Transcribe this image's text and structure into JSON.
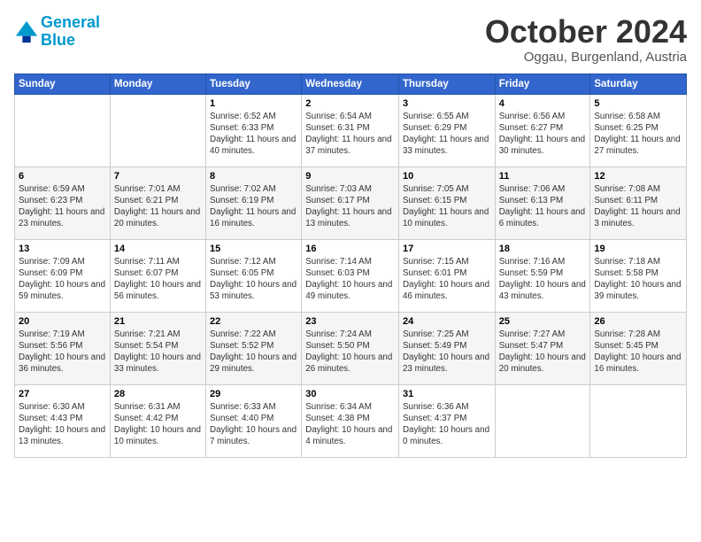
{
  "header": {
    "logo_line1": "General",
    "logo_line2": "Blue",
    "month_title": "October 2024",
    "location": "Oggau, Burgenland, Austria"
  },
  "weekdays": [
    "Sunday",
    "Monday",
    "Tuesday",
    "Wednesday",
    "Thursday",
    "Friday",
    "Saturday"
  ],
  "weeks": [
    [
      {
        "day": null
      },
      {
        "day": null
      },
      {
        "day": "1",
        "sunrise": "6:52 AM",
        "sunset": "6:33 PM",
        "daylight": "11 hours and 40 minutes."
      },
      {
        "day": "2",
        "sunrise": "6:54 AM",
        "sunset": "6:31 PM",
        "daylight": "11 hours and 37 minutes."
      },
      {
        "day": "3",
        "sunrise": "6:55 AM",
        "sunset": "6:29 PM",
        "daylight": "11 hours and 33 minutes."
      },
      {
        "day": "4",
        "sunrise": "6:56 AM",
        "sunset": "6:27 PM",
        "daylight": "11 hours and 30 minutes."
      },
      {
        "day": "5",
        "sunrise": "6:58 AM",
        "sunset": "6:25 PM",
        "daylight": "11 hours and 27 minutes."
      }
    ],
    [
      {
        "day": "6",
        "sunrise": "6:59 AM",
        "sunset": "6:23 PM",
        "daylight": "11 hours and 23 minutes."
      },
      {
        "day": "7",
        "sunrise": "7:01 AM",
        "sunset": "6:21 PM",
        "daylight": "11 hours and 20 minutes."
      },
      {
        "day": "8",
        "sunrise": "7:02 AM",
        "sunset": "6:19 PM",
        "daylight": "11 hours and 16 minutes."
      },
      {
        "day": "9",
        "sunrise": "7:03 AM",
        "sunset": "6:17 PM",
        "daylight": "11 hours and 13 minutes."
      },
      {
        "day": "10",
        "sunrise": "7:05 AM",
        "sunset": "6:15 PM",
        "daylight": "11 hours and 10 minutes."
      },
      {
        "day": "11",
        "sunrise": "7:06 AM",
        "sunset": "6:13 PM",
        "daylight": "11 hours and 6 minutes."
      },
      {
        "day": "12",
        "sunrise": "7:08 AM",
        "sunset": "6:11 PM",
        "daylight": "11 hours and 3 minutes."
      }
    ],
    [
      {
        "day": "13",
        "sunrise": "7:09 AM",
        "sunset": "6:09 PM",
        "daylight": "10 hours and 59 minutes."
      },
      {
        "day": "14",
        "sunrise": "7:11 AM",
        "sunset": "6:07 PM",
        "daylight": "10 hours and 56 minutes."
      },
      {
        "day": "15",
        "sunrise": "7:12 AM",
        "sunset": "6:05 PM",
        "daylight": "10 hours and 53 minutes."
      },
      {
        "day": "16",
        "sunrise": "7:14 AM",
        "sunset": "6:03 PM",
        "daylight": "10 hours and 49 minutes."
      },
      {
        "day": "17",
        "sunrise": "7:15 AM",
        "sunset": "6:01 PM",
        "daylight": "10 hours and 46 minutes."
      },
      {
        "day": "18",
        "sunrise": "7:16 AM",
        "sunset": "5:59 PM",
        "daylight": "10 hours and 43 minutes."
      },
      {
        "day": "19",
        "sunrise": "7:18 AM",
        "sunset": "5:58 PM",
        "daylight": "10 hours and 39 minutes."
      }
    ],
    [
      {
        "day": "20",
        "sunrise": "7:19 AM",
        "sunset": "5:56 PM",
        "daylight": "10 hours and 36 minutes."
      },
      {
        "day": "21",
        "sunrise": "7:21 AM",
        "sunset": "5:54 PM",
        "daylight": "10 hours and 33 minutes."
      },
      {
        "day": "22",
        "sunrise": "7:22 AM",
        "sunset": "5:52 PM",
        "daylight": "10 hours and 29 minutes."
      },
      {
        "day": "23",
        "sunrise": "7:24 AM",
        "sunset": "5:50 PM",
        "daylight": "10 hours and 26 minutes."
      },
      {
        "day": "24",
        "sunrise": "7:25 AM",
        "sunset": "5:49 PM",
        "daylight": "10 hours and 23 minutes."
      },
      {
        "day": "25",
        "sunrise": "7:27 AM",
        "sunset": "5:47 PM",
        "daylight": "10 hours and 20 minutes."
      },
      {
        "day": "26",
        "sunrise": "7:28 AM",
        "sunset": "5:45 PM",
        "daylight": "10 hours and 16 minutes."
      }
    ],
    [
      {
        "day": "27",
        "sunrise": "6:30 AM",
        "sunset": "4:43 PM",
        "daylight": "10 hours and 13 minutes."
      },
      {
        "day": "28",
        "sunrise": "6:31 AM",
        "sunset": "4:42 PM",
        "daylight": "10 hours and 10 minutes."
      },
      {
        "day": "29",
        "sunrise": "6:33 AM",
        "sunset": "4:40 PM",
        "daylight": "10 hours and 7 minutes."
      },
      {
        "day": "30",
        "sunrise": "6:34 AM",
        "sunset": "4:38 PM",
        "daylight": "10 hours and 4 minutes."
      },
      {
        "day": "31",
        "sunrise": "6:36 AM",
        "sunset": "4:37 PM",
        "daylight": "10 hours and 0 minutes."
      },
      {
        "day": null
      },
      {
        "day": null
      }
    ]
  ]
}
